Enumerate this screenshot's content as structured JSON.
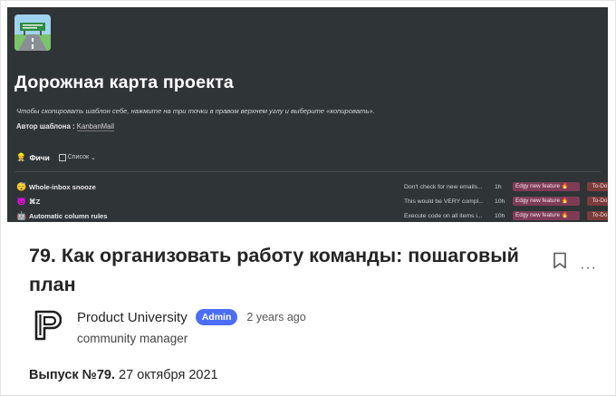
{
  "cover": {
    "title": "Дорожная карта проекта",
    "description": "Чтобы скопировать шаблон себе, нажмите на три точки в правом верхнем углу и выберите «копировать».",
    "author_label": "Автор шаблона :",
    "author_link": "KanbanMail",
    "section_emoji": "👷",
    "section_title": "Фичи",
    "view_label": "Список",
    "rows": [
      {
        "emoji": "😴",
        "name": "Whole-inbox snooze",
        "desc": "Don't check for new emails...",
        "estimate": "1h",
        "tag": "Edgy new feature 🔥",
        "status": "To-Do"
      },
      {
        "emoji": "😈",
        "name": "⌘Z",
        "desc": "This would be VERY compl...",
        "estimate": "10h",
        "tag": "Edgy new feature 🔥",
        "status": "To-Do"
      },
      {
        "emoji": "🤖",
        "name": "Automatic column rules",
        "desc": "Execute code on all items i...",
        "estimate": "10h",
        "tag": "Edgy new feature 🔥",
        "status": "To-Do"
      }
    ],
    "colors": {
      "background": "#2f3437",
      "tag_feature": "#7e3c57",
      "tag_status": "#7d3b3b"
    }
  },
  "post": {
    "title": "79. Как организовать работу команды: пошаговый план",
    "author_name": "Product University",
    "badge": "Admin",
    "time": "2 years ago",
    "role": "community manager",
    "issue_label": "Выпуск №79.",
    "issue_date": "27 октября 2021"
  },
  "icons": {
    "bookmark": "bookmark-icon",
    "more": "more-icon",
    "logo": "product-university-logo"
  },
  "accent": "#4c6ef5"
}
